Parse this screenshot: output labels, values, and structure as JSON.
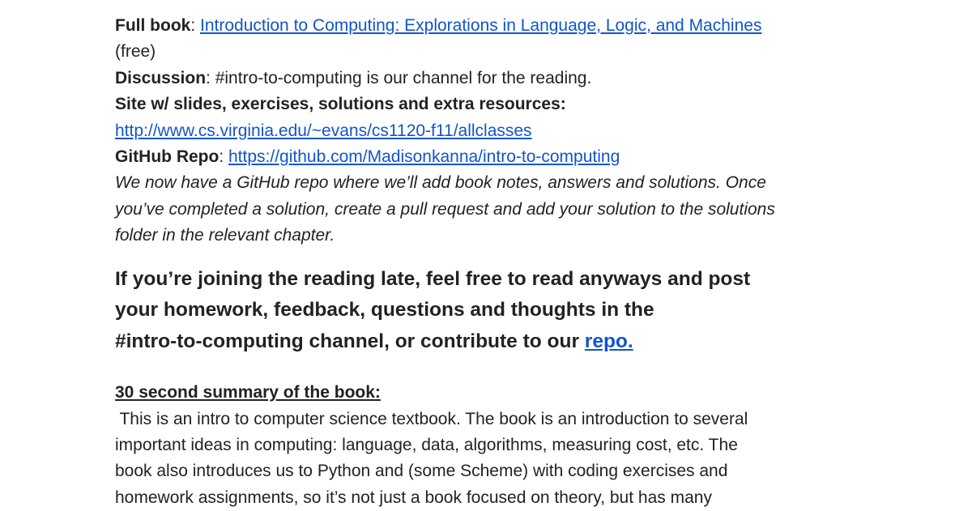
{
  "resources": {
    "full_book_label": "Full book",
    "full_book_link": "Introduction to Computing: Explorations in Language, Logic, and Machines",
    "free_note": "(free)",
    "discussion_label": "Discussion",
    "discussion_text": ": #intro-to-computing is our channel for the reading.",
    "site_label": "Site w/ slides, exercises, solutions and extra resources:",
    "site_link": "http://www.cs.virginia.edu/~evans/cs1120-f11/allclasses",
    "github_label": "GitHub Repo",
    "github_link": "https://github.com/Madisonkanna/intro-to-computing",
    "github_note_lines": [
      "We now have a GitHub repo where we’ll add book notes, answers and solutions. Once",
      "you’ve completed a solution, create a pull request and add your solution to the solutions",
      "folder in the relevant chapter."
    ]
  },
  "joining": {
    "lines": [
      "If you’re joining the reading late, feel free to read anyways and post",
      "your homework, feedback, questions and thoughts in the"
    ],
    "last_line_text": "#intro-to-computing channel, or contribute to our ",
    "repo_link": "repo."
  },
  "summary": {
    "heading": "30 second summary of the book:",
    "lines": [
      " This is an intro to computer science textbook. The book is an introduction to several",
      "important ideas in computing: language, data, algorithms, measuring cost, etc. The",
      "book also introduces us to Python and (some Scheme) with coding exercises and",
      "homework assignments, so it’s not just a book focused on theory, but has many"
    ]
  }
}
